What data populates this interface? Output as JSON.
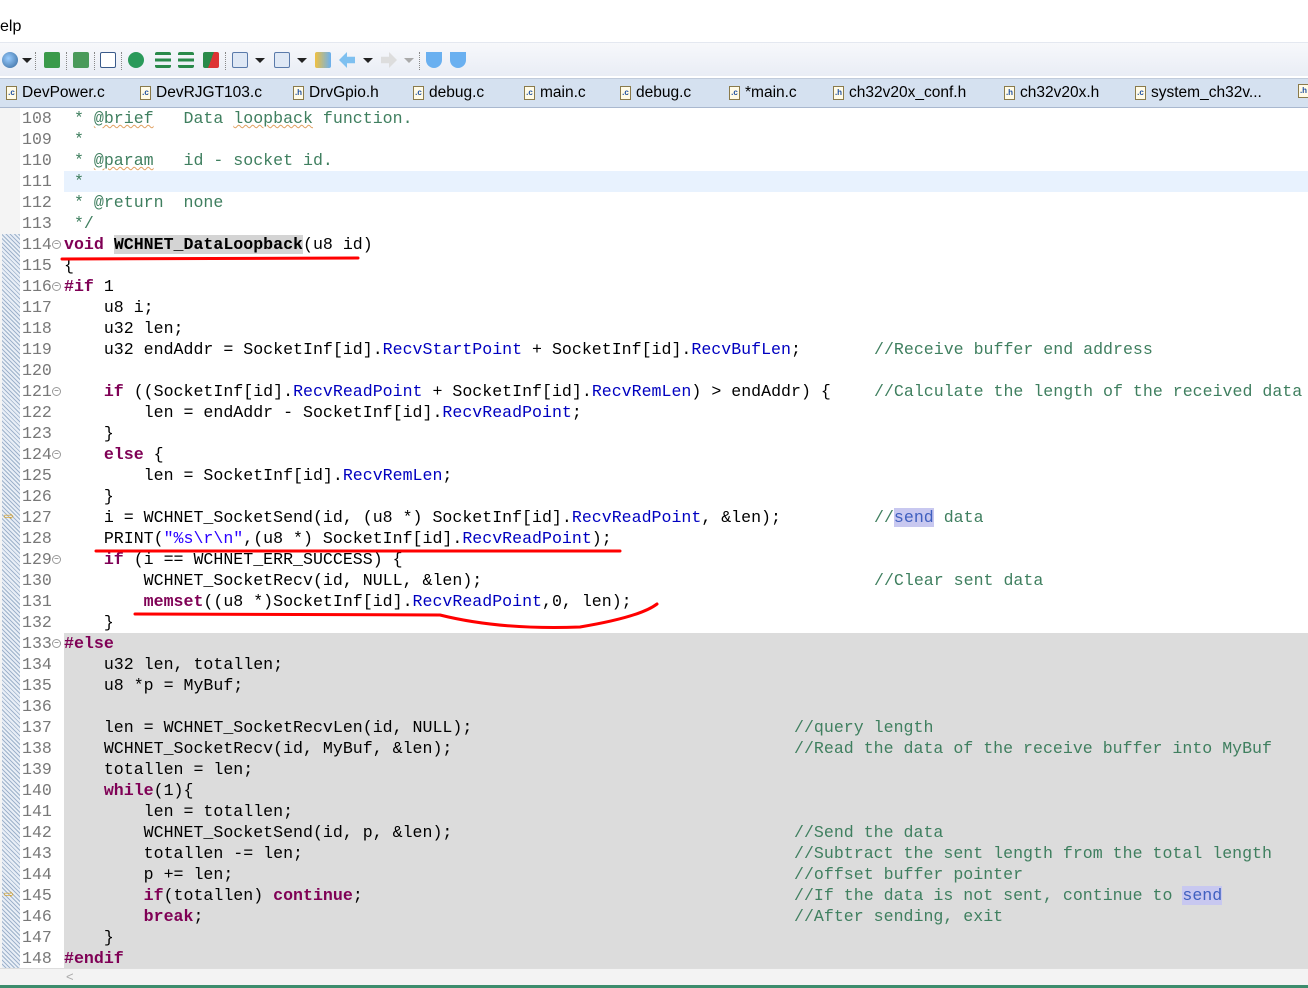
{
  "menu": {
    "partial_label": "elp"
  },
  "toolbar": {
    "icons": [
      "search-icon",
      "new-ld-icon",
      "help-file-icon",
      "console-icon",
      "debug-refresh-icon",
      "indent-icon",
      "outdent-icon",
      "toggle-comment-icon",
      "next-annotation-icon",
      "prev-annotation-icon",
      "last-edit-icon",
      "back-icon",
      "forward-icon",
      "prev-edit-icon",
      "next-edit-icon"
    ]
  },
  "tabs": [
    {
      "label": "DevPower.c",
      "type": "c"
    },
    {
      "label": "DevRJGT103.c",
      "type": "c"
    },
    {
      "label": "DrvGpio.h",
      "type": "h"
    },
    {
      "label": "debug.c",
      "type": "c"
    },
    {
      "label": "main.c",
      "type": "c"
    },
    {
      "label": "debug.c",
      "type": "c"
    },
    {
      "label": "*main.c",
      "type": "c"
    },
    {
      "label": "ch32v20x_conf.h",
      "type": "h"
    },
    {
      "label": "ch32v20x.h",
      "type": "h"
    },
    {
      "label": "system_ch32v...",
      "type": "c"
    },
    {
      "label": "",
      "type": "h"
    }
  ],
  "colors": {
    "keyword": "#7f0055",
    "field": "#0000c0",
    "comment": "#3f7f5f",
    "string": "#2a00ff",
    "inactive_bg": "#dcdcdc",
    "current_line": "#e8f2fe",
    "annotation": "#ff0000"
  },
  "lines": [
    {
      "n": "108",
      "t": [
        [
          "d",
          " * "
        ],
        [
          "dt",
          "@brief"
        ],
        [
          "d",
          "   Data "
        ],
        [
          "dt",
          "loopback"
        ],
        [
          "d",
          " function."
        ]
      ]
    },
    {
      "n": "109",
      "t": [
        [
          "d",
          " *"
        ]
      ]
    },
    {
      "n": "110",
      "t": [
        [
          "d",
          " * "
        ],
        [
          "dt",
          "@param"
        ],
        [
          "d",
          "   id - socket id."
        ]
      ]
    },
    {
      "n": "111",
      "t": [
        [
          "d",
          " *"
        ]
      ],
      "cur": true
    },
    {
      "n": "112",
      "t": [
        [
          "d",
          " * @return  none"
        ]
      ]
    },
    {
      "n": "113",
      "t": [
        [
          "d",
          " */"
        ]
      ]
    },
    {
      "n": "114",
      "t": [
        [
          "k",
          "void"
        ],
        [
          "",
          "",
          " "
        ],
        [
          "o",
          "WCHNET_DataLoopback"
        ],
        [
          "",
          "(u8 id)"
        ]
      ],
      "fold": true
    },
    {
      "n": "115",
      "t": [
        [
          "",
          "{"
        ]
      ]
    },
    {
      "n": "116",
      "t": [
        [
          "k",
          "#if"
        ],
        [
          "",
          " 1"
        ]
      ],
      "fold": true
    },
    {
      "n": "117",
      "t": [
        [
          "",
          "    u8 i;"
        ]
      ]
    },
    {
      "n": "118",
      "t": [
        [
          "",
          "    u32 len;"
        ]
      ]
    },
    {
      "n": "119",
      "t": [
        [
          "",
          "    u32 endAddr = SocketInf[id]."
        ],
        [
          "f",
          "RecvStartPoint"
        ],
        [
          "",
          " + SocketInf[id]."
        ],
        [
          "f",
          "RecvBufLen"
        ],
        [
          "",
          ";"
        ]
      ],
      "cm": "//Receive buffer end address"
    },
    {
      "n": "120",
      "t": []
    },
    {
      "n": "121",
      "t": [
        [
          "",
          "    "
        ],
        [
          "k",
          "if"
        ],
        [
          "",
          " ((SocketInf[id]."
        ],
        [
          "f",
          "RecvReadPoint"
        ],
        [
          "",
          " + SocketInf[id]."
        ],
        [
          "f",
          "RecvRemLen"
        ],
        [
          "",
          ") > endAddr) {"
        ]
      ],
      "cm": "//Calculate the length of the received data",
      "fold": true
    },
    {
      "n": "122",
      "t": [
        [
          "",
          "        len = endAddr - SocketInf[id]."
        ],
        [
          "f",
          "RecvReadPoint"
        ],
        [
          "",
          ";"
        ]
      ]
    },
    {
      "n": "123",
      "t": [
        [
          "",
          "    }"
        ]
      ]
    },
    {
      "n": "124",
      "t": [
        [
          "",
          "    "
        ],
        [
          "k",
          "else"
        ],
        [
          "",
          " {"
        ]
      ],
      "fold": true
    },
    {
      "n": "125",
      "t": [
        [
          "",
          "        len = SocketInf[id]."
        ],
        [
          "f",
          "RecvRemLen"
        ],
        [
          "",
          ";"
        ]
      ]
    },
    {
      "n": "126",
      "t": [
        [
          "",
          "    }"
        ]
      ]
    },
    {
      "n": "127",
      "t": [
        [
          "",
          "    i = WCHNET_SocketSend(id, (u8 *) SocketInf[id]."
        ],
        [
          "f",
          "RecvReadPoint"
        ],
        [
          "",
          ", &len);"
        ]
      ],
      "cm": "//",
      "cmh": "send",
      "cmr": " data",
      "arrow": true
    },
    {
      "n": "128",
      "t": [
        [
          "",
          "    PRINT("
        ],
        [
          "s",
          "\"%s\\r\\n\""
        ],
        [
          "",
          ",(u8 *) SocketInf[id]."
        ],
        [
          "f",
          "RecvReadPoint"
        ],
        [
          "",
          ");"
        ]
      ]
    },
    {
      "n": "129",
      "t": [
        [
          "",
          "    "
        ],
        [
          "k",
          "if"
        ],
        [
          "",
          " (i == WCHNET_ERR_SUCCESS) {"
        ]
      ],
      "fold": true
    },
    {
      "n": "130",
      "t": [
        [
          "",
          "        WCHNET_SocketRecv(id, NULL, &len);"
        ]
      ],
      "cm": "//Clear sent data"
    },
    {
      "n": "131",
      "t": [
        [
          "",
          "        "
        ],
        [
          "k",
          "memset"
        ],
        [
          "",
          "((u8 *)SocketInf[id]."
        ],
        [
          "f",
          "RecvReadPoint"
        ],
        [
          "",
          ",0, len);"
        ]
      ]
    },
    {
      "n": "132",
      "t": [
        [
          "",
          "    }"
        ]
      ]
    },
    {
      "n": "133",
      "t": [
        [
          "k",
          "#else"
        ]
      ],
      "fold": true,
      "gray": true
    },
    {
      "n": "134",
      "t": [
        [
          "",
          "    u32 len, totallen;"
        ]
      ],
      "gray": true
    },
    {
      "n": "135",
      "t": [
        [
          "",
          "    u8 *p = MyBuf;"
        ]
      ],
      "gray": true
    },
    {
      "n": "136",
      "t": [],
      "gray": true
    },
    {
      "n": "137",
      "t": [
        [
          "",
          "    len = WCHNET_SocketRecvLen(id, NULL);"
        ]
      ],
      "cm": "//query length",
      "gray": true
    },
    {
      "n": "138",
      "t": [
        [
          "",
          "    WCHNET_SocketRecv(id, MyBuf, &len);"
        ]
      ],
      "cm": "//Read the data of the receive buffer into MyBuf",
      "gray": true
    },
    {
      "n": "139",
      "t": [
        [
          "",
          "    totallen = len;"
        ]
      ],
      "gray": true
    },
    {
      "n": "140",
      "t": [
        [
          "",
          "    "
        ],
        [
          "k",
          "while"
        ],
        [
          "",
          "(1){"
        ]
      ],
      "gray": true
    },
    {
      "n": "141",
      "t": [
        [
          "",
          "        len = totallen;"
        ]
      ],
      "gray": true
    },
    {
      "n": "142",
      "t": [
        [
          "",
          "        WCHNET_SocketSend(id, p, &len);"
        ]
      ],
      "cm": "//Send the data",
      "gray": true
    },
    {
      "n": "143",
      "t": [
        [
          "",
          "        totallen -= len;"
        ]
      ],
      "cm": "//Subtract the sent length from the total length",
      "gray": true
    },
    {
      "n": "144",
      "t": [
        [
          "",
          "        p += len;"
        ]
      ],
      "cm": "//offset buffer pointer",
      "gray": true
    },
    {
      "n": "145",
      "t": [
        [
          "",
          "        "
        ],
        [
          "k",
          "if"
        ],
        [
          "",
          "(totallen) "
        ],
        [
          "k",
          "continue"
        ],
        [
          "",
          ";"
        ]
      ],
      "cm": "//If the data is not sent, continue to ",
      "cmh": "send",
      "gray": true,
      "arrow": true
    },
    {
      "n": "146",
      "t": [
        [
          "",
          "        "
        ],
        [
          "k",
          "break"
        ],
        [
          "",
          ";"
        ]
      ],
      "cm": "//After sending, exit",
      "gray": true
    },
    {
      "n": "147",
      "t": [
        [
          "",
          "    }"
        ]
      ],
      "gray": true
    },
    {
      "n": "148",
      "t": [
        [
          "k",
          "#endif"
        ]
      ],
      "gray": true
    }
  ],
  "scrollbar": {
    "left_arrow": "<"
  }
}
